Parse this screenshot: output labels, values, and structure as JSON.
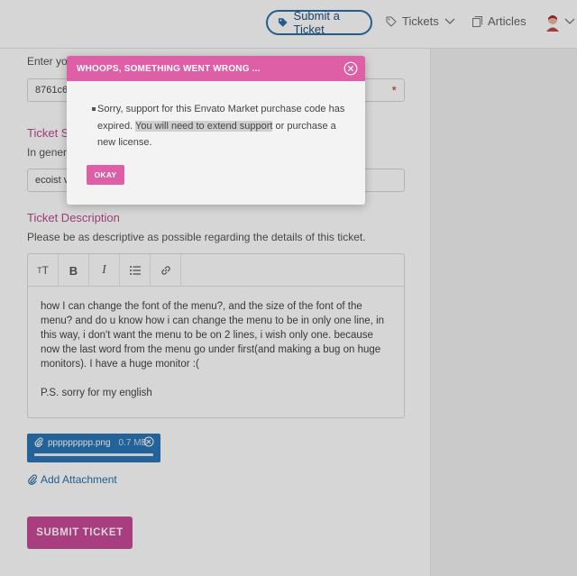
{
  "nav": {
    "submit_label": "Submit a Ticket",
    "tickets_label": "Tickets",
    "articles_label": "Articles"
  },
  "form": {
    "purchase_label_partial": "Enter you",
    "purchase_value_partial": "8761c6",
    "subject_title_partial": "Ticket S",
    "subject_hint_partial": "In genera",
    "subject_value_partial": "ecoist  v",
    "description_title": "Ticket Description",
    "description_hint": "Please be as descriptive as possible regarding the details of this ticket.",
    "editor_tools": [
      "text-size",
      "bold",
      "italic",
      "bulleted-list",
      "link"
    ],
    "description_paragraph1": "how I can change the font of the menu?, and the size of the font of the menu? and do u know how i can change the menu to be in only one line, in this way, i don't want the menu to be on 2 lines, i wish only one. because now the last word from the menu go under first(and making a bug on huge monitors). I have a huge monitor :(",
    "description_paragraph2": "P.S. sorry for my english",
    "attachment": {
      "name": "ppppppppp.png",
      "size": "0.7 MB",
      "progress": 1.0
    },
    "add_attachment_label": "Add Attachment",
    "submit_label": "SUBMIT TICKET"
  },
  "modal": {
    "title": "WHOOPS, SOMETHING WENT WRONG ...",
    "message_part1": "Sorry, support for this Envato Market purchase code has expired. ",
    "message_highlight": "You will need to extend support",
    "message_part2": " or purchase a new license.",
    "okay_label": "OKAY"
  },
  "colors": {
    "accent_pink": "#de5fa6",
    "submit_pink": "#c94b98",
    "link_blue": "#2a6fa8",
    "attachment_blue": "#2a77b7"
  }
}
